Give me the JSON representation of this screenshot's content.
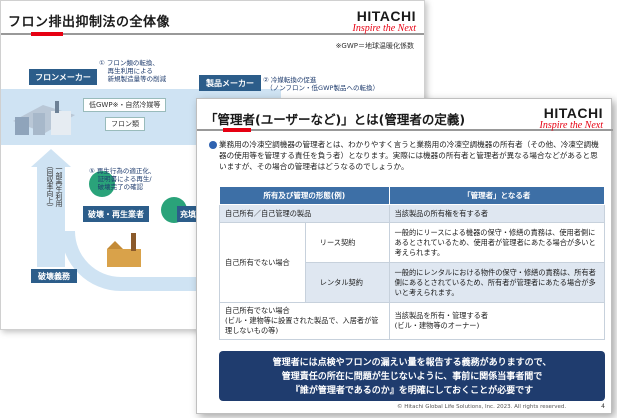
{
  "back": {
    "title": "フロン排出抑制法の全体像",
    "logo_main": "HITACHI",
    "logo_sub": "Inspire the Next",
    "note": "※GWP＝地球温暖化係数",
    "box_maker": "フロンメーカー",
    "box_product": "製品メーカー",
    "text_1": "① フロン類の転換、\n　 再生利用による\n　 新規製造量等の削減",
    "text_2": "② 冷媒転換の促進\n　（ノンフロン・低GWP製品への転換）",
    "pill_low": "低GWP※・自然冷媒等",
    "pill_fron": "フロン類",
    "vertical_text": "一部再生利用（回収率向上）",
    "text_5": "⑤ 再生行為の適正化、\n　 証明書による再生/\n　 破壊完了の確認",
    "box_destroy": "破壊・再生業者",
    "box_filling": "充填",
    "box_obligation": "破壊義務"
  },
  "front": {
    "title": "「管理者(ユーザーなど)」とは(管理者の定義)",
    "logo_main": "HITACHI",
    "logo_sub": "Inspire the Next",
    "intro": "業務用の冷凍空調機器の管理者とは、わかりやすく言うと業務用の冷凍空調機器の所有者（その他、冷凍空調機器の使用等を管理する責任を負う者）となります。実際には機器の所有者と管理者が異なる場合などがあると思いますが、その場合の管理者はどうなるのでしょうか。",
    "table": {
      "header_left": "所有及び管理の形態(例)",
      "header_right": "「管理者」となる者",
      "rows": [
        {
          "c1": "自己所有／自己管理の製品",
          "c2": "",
          "c3": "当該製品の所有権を有する者"
        },
        {
          "c1": "自己所有でない場合",
          "c2": "リース契約",
          "c3": "一般的にリースによる機器の保守・修繕の責務は、使用者側にあるとされているため、使用者が管理者にあたる場合が多いと考えられます。"
        },
        {
          "c1": "",
          "c2": "レンタル契約",
          "c3": "一般的にレンタルにおける物件の保守・修繕の責務は、所有者側にあるとされているため、所有者が管理者にあたる場合が多いと考えられます。"
        },
        {
          "c1": "自己所有でない場合\n(ビル・建物等に設置された製品で、入居者が管理しないもの等)",
          "c2": "",
          "c3": "当該製品を所有・管理する者\n(ビル・建物等のオーナー)"
        }
      ]
    },
    "banner": "管理者には点検やフロンの漏えい量を報告する義務がありますので、\n管理責任の所在に問題が生じないように、事前に関係当事者間で\n『誰が管理者であるのか』を明確にしておくことが必要です",
    "copyright": "© Hitachi Global Life Solutions, Inc. 2023. All rights reserved.",
    "page_number": "4"
  },
  "colors": {
    "accent_red": "#e60012",
    "navy": "#1f3c6e",
    "table_header": "#3d6fa6",
    "table_alt": "#dfe7f1"
  }
}
